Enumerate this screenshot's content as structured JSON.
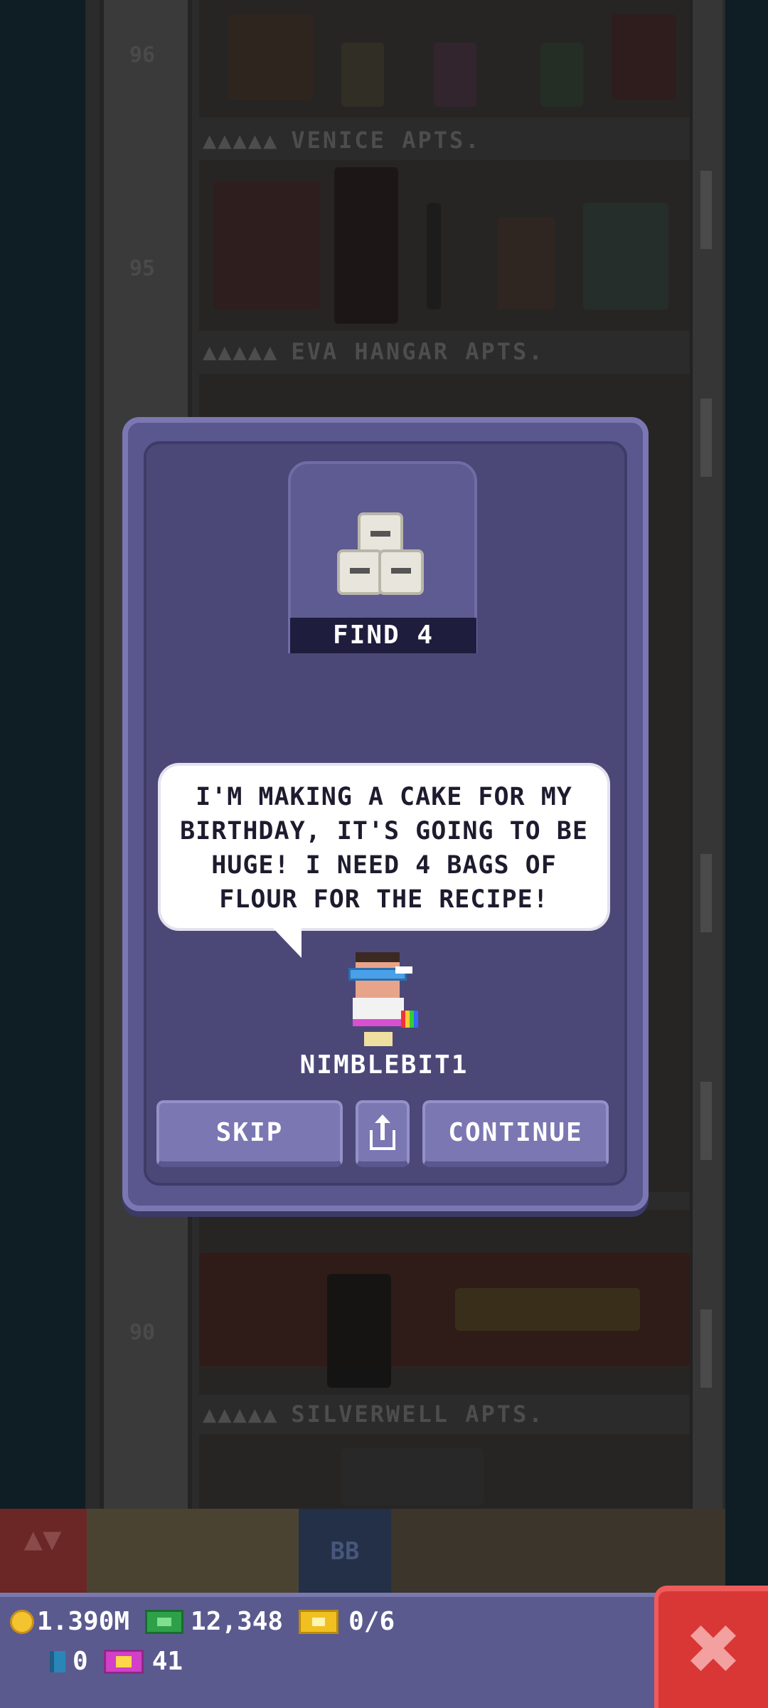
{
  "tower": {
    "floors": [
      {
        "label": "VENICE APTS.",
        "dots": "▲▲▲▲▲",
        "number": "96"
      },
      {
        "label": "EVA HANGAR APTS.",
        "dots": "▲▲▲▲▲",
        "number": "95"
      },
      {
        "label": "SILVERWELL APTS.",
        "dots": "▲▲▲▲▲",
        "number": "90"
      }
    ],
    "lobby_sign": "BB",
    "elevator_arrows": "▲▼"
  },
  "mission": {
    "find_label": "FIND 4",
    "item_icon": "flour-bags-icon",
    "message": "I'M MAKING A CAKE FOR MY BIRTHDAY, IT'S GOING TO BE HUGE! I NEED 4 BAGS OF FLOUR FOR THE RECIPE!",
    "player_name": "NIMBLEBIT1",
    "buttons": {
      "skip": "SKIP",
      "share_icon": "share-icon",
      "continue": "CONTINUE"
    }
  },
  "hud": {
    "coins": "1.390M",
    "bux": "12,348",
    "tickets": "0/6",
    "keys": "0",
    "golden_tickets": "41",
    "close_icon": "close-icon"
  },
  "colors": {
    "dialog": "#5a578e",
    "dialog_inner": "#4b4878",
    "hud": "#5b5a8f",
    "close": "#d93636"
  }
}
